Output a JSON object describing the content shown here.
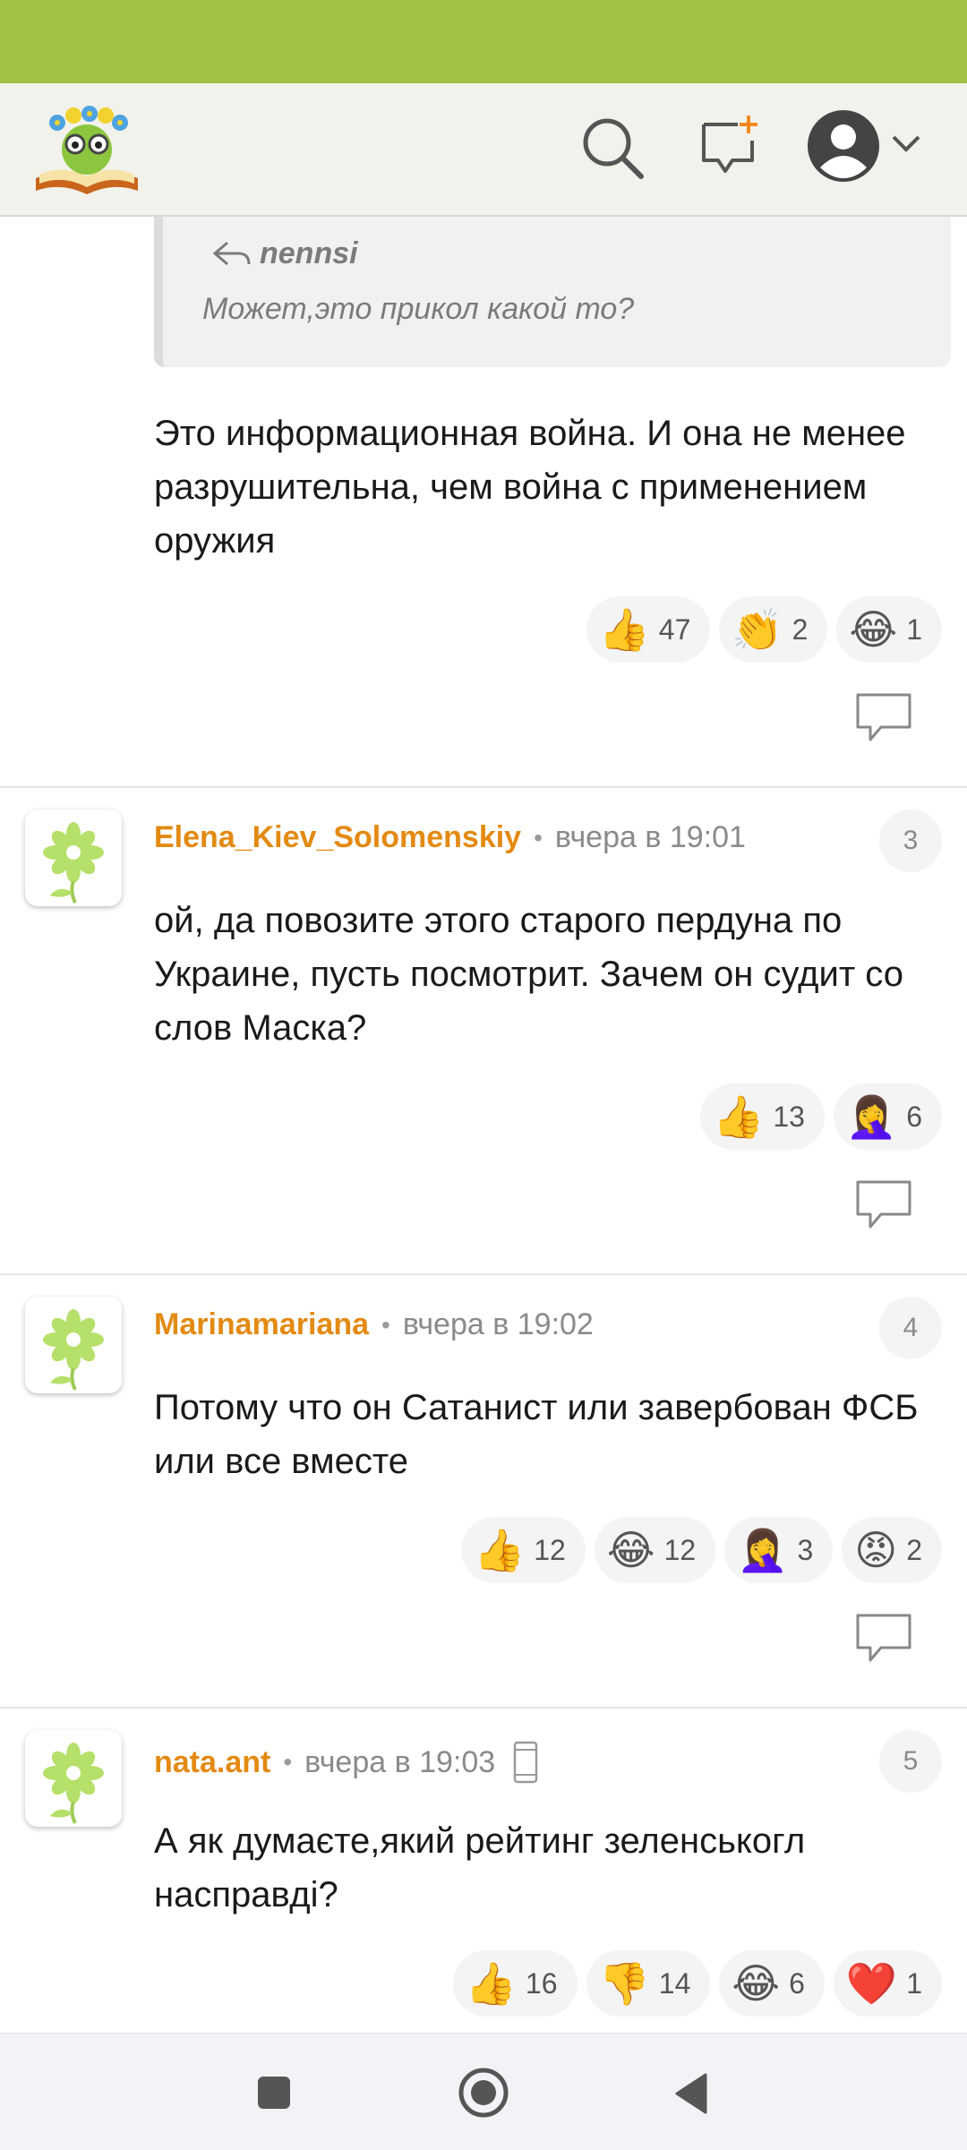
{
  "quote": {
    "author": "nennsi",
    "text": "Может,это прикол какой то?"
  },
  "reply_text": "Это информационная война. И она не менее разрушительна, чем война с применением оружия",
  "reply_reactions": [
    {
      "emoji": "👍",
      "count": "47"
    },
    {
      "emoji": "👏",
      "count": "2"
    },
    {
      "emoji": "😂",
      "count": "1"
    }
  ],
  "comments": [
    {
      "author": "Elena_Kiev_Solomenskiy",
      "time": "вчера в 19:01",
      "number": "3",
      "text": "ой, да повозите этого старого пердуна по Украине, пусть посмотрит. Зачем он судит со слов Маска?",
      "reactions": [
        {
          "emoji": "👍",
          "count": "13"
        },
        {
          "emoji": "🤦‍♀️",
          "count": "6"
        }
      ]
    },
    {
      "author": "Marinamariana",
      "time": "вчера в 19:02",
      "number": "4",
      "text": "Потому что он Сатанист или завербован ФСБ или все вместе",
      "reactions": [
        {
          "emoji": "👍",
          "count": "12"
        },
        {
          "emoji": "😂",
          "count": "12"
        },
        {
          "emoji": "🤦‍♀️",
          "count": "3"
        },
        {
          "emoji": "😡",
          "count": "2"
        }
      ]
    },
    {
      "author": "nata.ant",
      "time": "вчера в 19:03",
      "number": "5",
      "text": "А як думаєте,який рейтинг зеленськогл насправді?",
      "reactions": [
        {
          "emoji": "👍",
          "count": "16"
        },
        {
          "emoji": "👎",
          "count": "14"
        },
        {
          "emoji": "😂",
          "count": "6"
        },
        {
          "emoji": "❤️",
          "count": "1"
        }
      ]
    }
  ],
  "icons": {
    "header": [
      "logo-icon",
      "search-icon",
      "new-post-icon",
      "profile-icon",
      "chevron-down-icon"
    ],
    "comment": [
      "reply-icon",
      "mobile-device-icon",
      "flower-avatar-icon"
    ],
    "navbar": [
      "recents-icon",
      "home-icon",
      "back-icon"
    ]
  },
  "colors": {
    "statusbar": "#9fc244",
    "author": "#e38a12",
    "header": "#f2f2ec"
  }
}
